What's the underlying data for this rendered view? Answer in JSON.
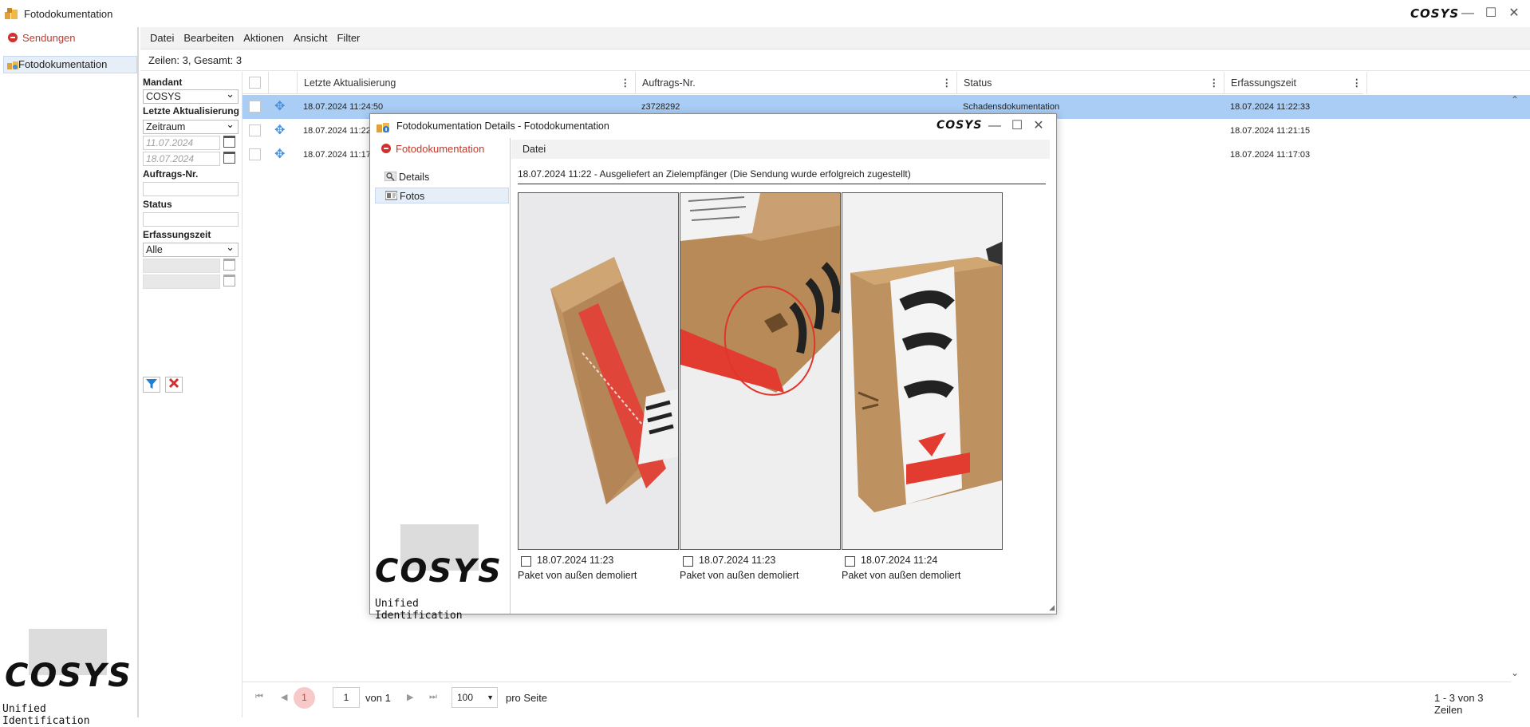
{
  "window": {
    "title": "Fotodokumentation",
    "brand": "COSYS",
    "controls": {
      "minimize": "—",
      "maximize": "☐",
      "close": "✕"
    }
  },
  "sidebar": {
    "back_label": "Sendungen",
    "items": [
      {
        "label": "Fotodokumentation",
        "active": true
      }
    ],
    "logo": {
      "word": "COSYS",
      "tagline": "Unified Identification"
    }
  },
  "menu": {
    "items": [
      "Datei",
      "Bearbeiten",
      "Aktionen",
      "Ansicht",
      "Filter"
    ]
  },
  "summary": "Zeilen: 3, Gesamt: 3",
  "filters": {
    "mandant_label": "Mandant",
    "mandant_value": "COSYS",
    "last_update_label": "Letzte Aktualisierung",
    "last_update_mode": "Zeitraum",
    "date_from": "11.07.2024",
    "date_to": "18.07.2024",
    "order_label": "Auftrags-Nr.",
    "status_label": "Status",
    "capture_label": "Erfassungszeit",
    "capture_value": "Alle",
    "apply_icon": "filter-icon",
    "clear_icon": "clear-filter-icon"
  },
  "table": {
    "columns": [
      "Letzte Aktualisierung",
      "Auftrags-Nr.",
      "Status",
      "Erfassungszeit"
    ],
    "rows": [
      {
        "updated": "18.07.2024 11:24:50",
        "order": "z3728292",
        "status": "Schadensdokumentation",
        "captured": "18.07.2024 11:22:33",
        "selected": true
      },
      {
        "updated": "18.07.2024 11:22:",
        "order": "",
        "status": "",
        "captured": "18.07.2024 11:21:15",
        "selected": false
      },
      {
        "updated": "18.07.2024 11:17:",
        "order": "",
        "status": "",
        "captured": "18.07.2024 11:17:03",
        "selected": false
      }
    ]
  },
  "pager": {
    "current_page": "1",
    "page_input": "1",
    "of_label": "von 1",
    "page_size": "100",
    "per_page_label": "pro Seite",
    "range_label": "1 - 3 von 3 Zeilen"
  },
  "dialog": {
    "title": "Fotodokumentation Details - Fotodokumentation",
    "back_label": "Fotodokumentation",
    "nav": [
      {
        "label": "Details",
        "icon": "magnifier-icon"
      },
      {
        "label": "Fotos",
        "icon": "photo-icon",
        "active": true
      }
    ],
    "menu": "Datei",
    "delivery_line": "18.07.2024 11:22 - Ausgeliefert an Zielempfänger (Die Sendung wurde erfolgreich zugestellt)",
    "photos": [
      {
        "time": "18.07.2024 11:23",
        "caption": "Paket von außen demoliert"
      },
      {
        "time": "18.07.2024 11:23",
        "caption": "Paket von außen demoliert"
      },
      {
        "time": "18.07.2024 11:24",
        "caption": "Paket von außen demoliert"
      }
    ],
    "logo": {
      "word": "COSYS",
      "tagline": "Unified Identification"
    }
  }
}
